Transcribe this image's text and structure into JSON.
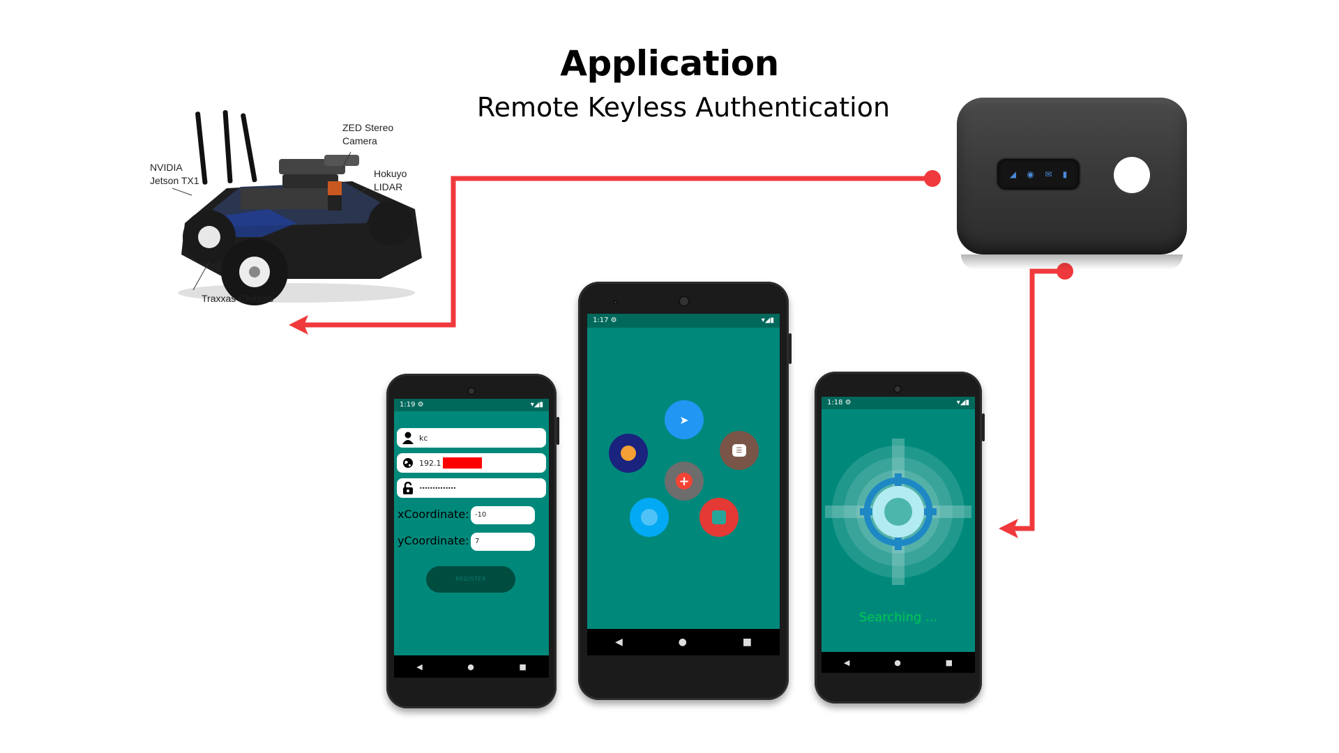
{
  "header": {
    "title": "Application",
    "subtitle": "Remote Keyless Authentication"
  },
  "car": {
    "labels": {
      "camera": "ZED Stereo\nCamera",
      "jetson": "NVIDIA\nJetson TX1",
      "lidar": "Hokuyo\nLIDAR",
      "chassis": "Traxxas Chassis"
    }
  },
  "phone_register": {
    "status_time": "1:19",
    "username": "kc",
    "ip_prefix": "192.1",
    "password_mask": "••••••••••••••",
    "x_label": "xCoordinate:",
    "x_value": "-10",
    "y_label": "yCoordinate:",
    "y_value": "7",
    "register_label": "REGISTER"
  },
  "phone_menu": {
    "status_time": "1:17"
  },
  "phone_search": {
    "status_time": "1:18",
    "status_text": "Searching ..."
  },
  "colors": {
    "arrow": "#f0393c",
    "screen": "#00897b",
    "statusbar": "#00695c",
    "searching_text": "#00c853"
  },
  "icons": {
    "nav_back": "◀",
    "nav_home": "●",
    "nav_recent": "■",
    "status_right": "▾◢▮",
    "gear": "⚙"
  }
}
